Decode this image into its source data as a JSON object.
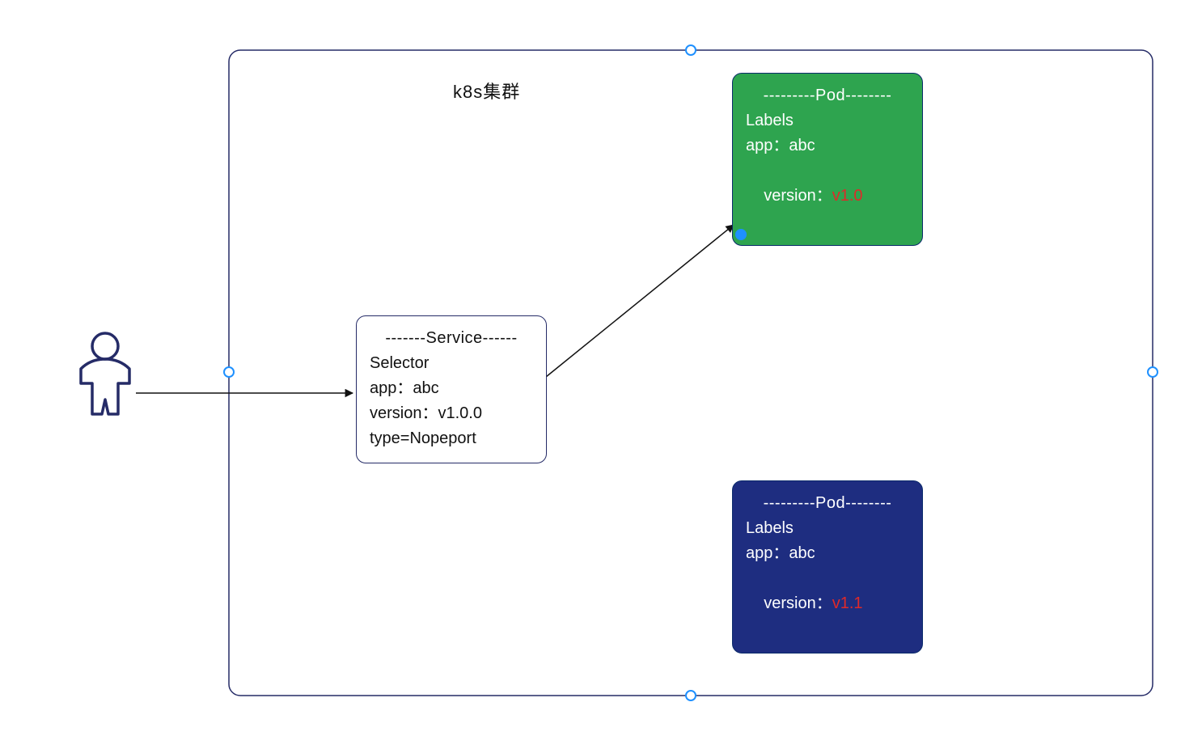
{
  "cluster_title": "k8s集群",
  "service": {
    "header": "-------Service------",
    "line1": "Selector",
    "line2": "app：abc",
    "line3": "version：v1.0.0",
    "line4": "type=Nopeport"
  },
  "pod_green": {
    "header": "---------Pod--------",
    "line1": "Labels",
    "line2": "app：abc",
    "line3_prefix": "version：",
    "line3_version": "v1.0"
  },
  "pod_navy": {
    "header": "---------Pod--------",
    "line1": "Labels",
    "line2": "app：abc",
    "line3_prefix": "version：",
    "line3_version": "v1.1"
  }
}
